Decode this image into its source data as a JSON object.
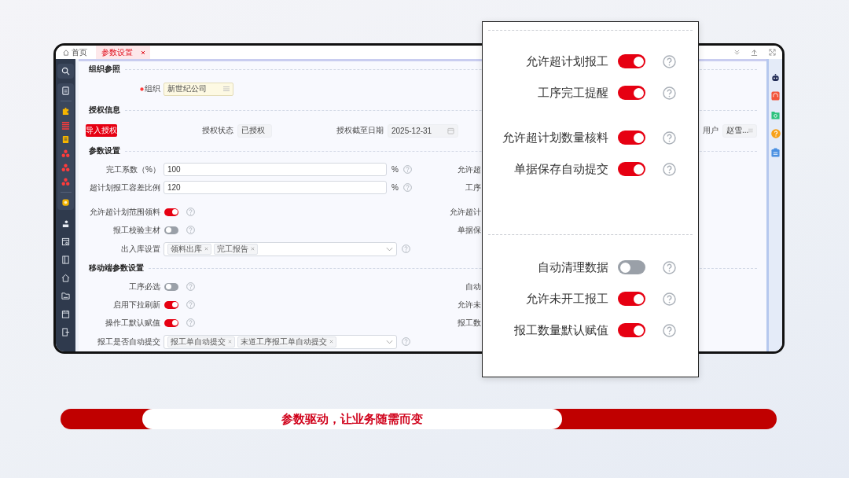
{
  "tabs": [
    {
      "label": "首页",
      "selected": false
    },
    {
      "label": "参数设置",
      "selected": true
    }
  ],
  "sections": [
    {
      "title": "组织参照",
      "rows": [
        {
          "kind": "picker",
          "label": "组织",
          "required": true,
          "value": "新世纪公司"
        }
      ]
    },
    {
      "title": "授权信息",
      "rows": [
        {
          "kind": "auth",
          "button": "导入授权",
          "fields": [
            {
              "kind": "plain",
              "label": "授权状态",
              "value": "已授权"
            },
            {
              "kind": "date",
              "label": "授权截至日期",
              "value": "2025-12-31"
            },
            {
              "kind": "picker",
              "label": "用户",
              "value": "赵雪..."
            }
          ]
        }
      ]
    },
    {
      "title": "参数设置",
      "rows": [
        {
          "kind": "input",
          "label": "完工系数（%）",
          "value": "100",
          "unit": "%",
          "right_label": "允许超"
        },
        {
          "kind": "input",
          "label": "超计划报工容差比例",
          "value": "120",
          "unit": "%",
          "right_label": "工序"
        },
        {
          "kind": "toggle",
          "label": "允许超计划范围领料",
          "on": true,
          "right_label": "允许超计"
        },
        {
          "kind": "toggle",
          "label": "报工校验主材",
          "on": false,
          "right_label": "单据保"
        },
        {
          "kind": "tags",
          "label": "出入库设置",
          "tags": [
            "领料出库",
            "完工报告"
          ]
        }
      ]
    },
    {
      "title": "移动端参数设置",
      "rows": [
        {
          "kind": "toggle",
          "label": "工序必选",
          "on": false,
          "right_label": "自动"
        },
        {
          "kind": "toggle",
          "label": "启用下拉刷新",
          "on": true,
          "right_label": "允许未"
        },
        {
          "kind": "toggle",
          "label": "操作工默认赋值",
          "on": true,
          "right_label": "报工数"
        },
        {
          "kind": "tags",
          "label": "报工是否自动提交",
          "tags": [
            "报工单自动提交",
            "末道工序报工单自动提交"
          ]
        }
      ]
    }
  ],
  "callout": {
    "groups": [
      {
        "divider": true,
        "items": [
          {
            "label": "允许超计划报工",
            "on": true
          },
          {
            "label": "工序完工提醒",
            "on": true
          }
        ]
      },
      {
        "divider": false,
        "items": [
          {
            "label": "允许超计划数量核料",
            "on": true
          },
          {
            "label": "单据保存自动提交",
            "on": true
          }
        ]
      },
      {
        "divider": true,
        "items": [
          {
            "label": "自动清理数据",
            "on": false
          },
          {
            "label": "允许未开工报工",
            "on": true
          },
          {
            "label": "报工数量默认赋值",
            "on": true
          }
        ]
      }
    ]
  },
  "slogan": "参数驱动，让业务随需而变"
}
